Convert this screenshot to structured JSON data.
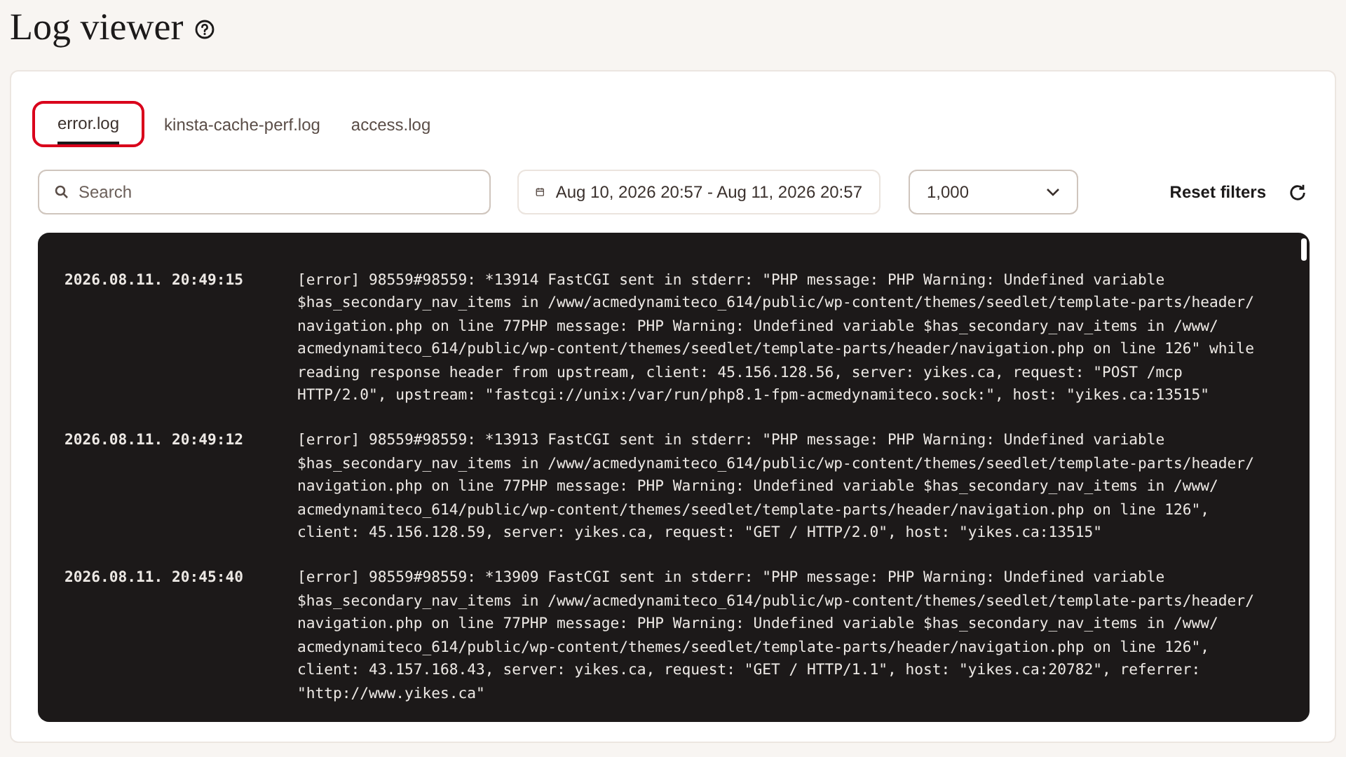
{
  "page": {
    "title": "Log viewer"
  },
  "tabs": [
    {
      "label": "error.log",
      "selected": true
    },
    {
      "label": "kinsta-cache-perf.log",
      "selected": false
    },
    {
      "label": "access.log",
      "selected": false
    }
  ],
  "filters": {
    "search": {
      "placeholder": "Search"
    },
    "date_range": "Aug 10, 2026 20:57 - Aug 11, 2026 20:57",
    "limit": "1,000",
    "reset": "Reset filters"
  },
  "entries": [
    {
      "time": "2026.08.11. 20:49:15",
      "message": "[error] 98559#98559: *13914 FastCGI sent in stderr: \"PHP message: PHP Warning: Undefined variable\n$has_secondary_nav_items in /www/acmedynamiteco_614/public/wp-content/themes/seedlet/template-parts/header/\nnavigation.php on line 77PHP message: PHP Warning: Undefined variable $has_secondary_nav_items in /www/\nacmedynamiteco_614/public/wp-content/themes/seedlet/template-parts/header/navigation.php on line 126\" while\nreading response header from upstream, client: 45.156.128.56, server: yikes.ca, request: \"POST /mcp\nHTTP/2.0\", upstream: \"fastcgi://unix:/var/run/php8.1-fpm-acmedynamiteco.sock:\", host: \"yikes.ca:13515\""
    },
    {
      "time": "2026.08.11. 20:49:12",
      "message": "[error] 98559#98559: *13913 FastCGI sent in stderr: \"PHP message: PHP Warning: Undefined variable\n$has_secondary_nav_items in /www/acmedynamiteco_614/public/wp-content/themes/seedlet/template-parts/header/\nnavigation.php on line 77PHP message: PHP Warning: Undefined variable $has_secondary_nav_items in /www/\nacmedynamiteco_614/public/wp-content/themes/seedlet/template-parts/header/navigation.php on line 126\",\nclient: 45.156.128.59, server: yikes.ca, request: \"GET / HTTP/2.0\", host: \"yikes.ca:13515\""
    },
    {
      "time": "2026.08.11. 20:45:40",
      "message": "[error] 98559#98559: *13909 FastCGI sent in stderr: \"PHP message: PHP Warning: Undefined variable\n$has_secondary_nav_items in /www/acmedynamiteco_614/public/wp-content/themes/seedlet/template-parts/header/\nnavigation.php on line 77PHP message: PHP Warning: Undefined variable $has_secondary_nav_items in /www/\nacmedynamiteco_614/public/wp-content/themes/seedlet/template-parts/header/navigation.php on line 126\",\nclient: 43.157.168.43, server: yikes.ca, request: \"GET / HTTP/1.1\", host: \"yikes.ca:20782\", referrer:\n\"http://www.yikes.ca\""
    }
  ]
}
